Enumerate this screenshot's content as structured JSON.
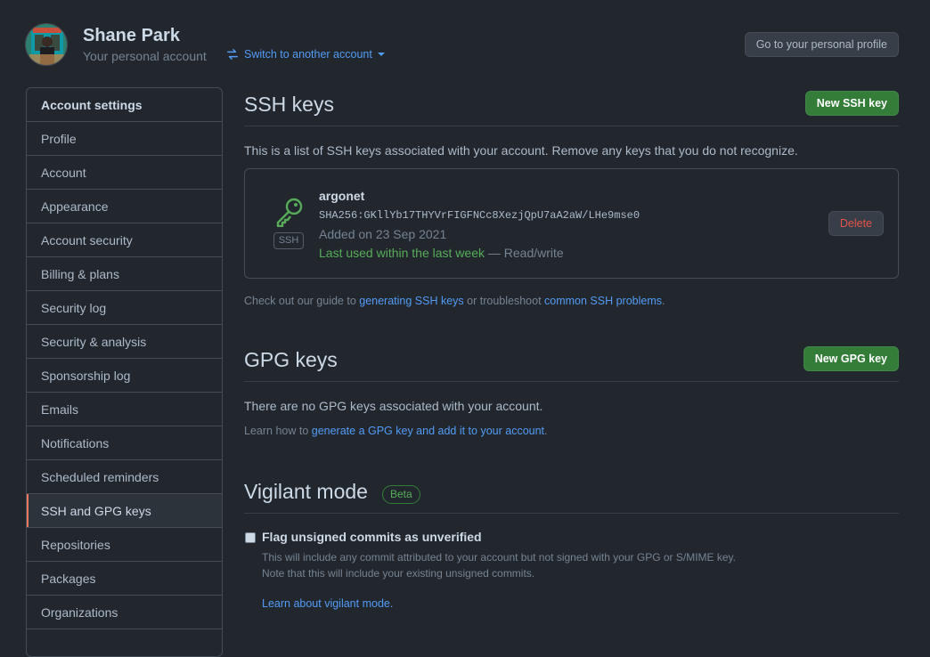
{
  "header": {
    "user_name": "Shane Park",
    "subtitle": "Your personal account",
    "switch_label": "Switch to another account",
    "profile_button": "Go to your personal profile"
  },
  "sidebar": {
    "heading": "Account settings",
    "items": [
      {
        "label": "Profile"
      },
      {
        "label": "Account"
      },
      {
        "label": "Appearance"
      },
      {
        "label": "Account security"
      },
      {
        "label": "Billing & plans"
      },
      {
        "label": "Security log"
      },
      {
        "label": "Security & analysis"
      },
      {
        "label": "Sponsorship log"
      },
      {
        "label": "Emails"
      },
      {
        "label": "Notifications"
      },
      {
        "label": "Scheduled reminders"
      },
      {
        "label": "SSH and GPG keys",
        "active": true
      },
      {
        "label": "Repositories"
      },
      {
        "label": "Packages"
      },
      {
        "label": "Organizations"
      }
    ]
  },
  "ssh": {
    "title": "SSH keys",
    "new_button": "New SSH key",
    "intro": "This is a list of SSH keys associated with your account. Remove any keys that you do not recognize.",
    "key": {
      "type_label": "SSH",
      "name": "argonet",
      "fingerprint": "SHA256:GKllYb17THYVrFIGFNCc8XezjQpU7aA2aW/LHe9mse0",
      "added": "Added on 23 Sep 2021",
      "last_used": "Last used within the last week",
      "access": " — Read/write",
      "delete_button": "Delete"
    },
    "note_prefix": "Check out our guide to ",
    "note_link1": "generating SSH keys",
    "note_middle": " or troubleshoot ",
    "note_link2": "common SSH problems",
    "note_suffix": "."
  },
  "gpg": {
    "title": "GPG keys",
    "new_button": "New GPG key",
    "empty": "There are no GPG keys associated with your account.",
    "note_prefix": "Learn how to ",
    "note_link": "generate a GPG key and add it to your account",
    "note_suffix": "."
  },
  "vigilant": {
    "title": "Vigilant mode",
    "badge": "Beta",
    "checkbox_label": "Flag unsigned commits as unverified",
    "desc_line1": "This will include any commit attributed to your account but not signed with your GPG or S/MIME key.",
    "desc_line2": "Note that this will include your existing unsigned commits.",
    "learn_link": "Learn about vigilant mode."
  },
  "colors": {
    "background": "#22272e",
    "accent_green": "#347d39",
    "link_blue": "#539bf5",
    "danger_red": "#e5534b",
    "active_marker": "#ec775c"
  },
  "icons": [
    "avatar",
    "switch-arrows-icon",
    "caret-down-icon",
    "key-icon"
  ]
}
